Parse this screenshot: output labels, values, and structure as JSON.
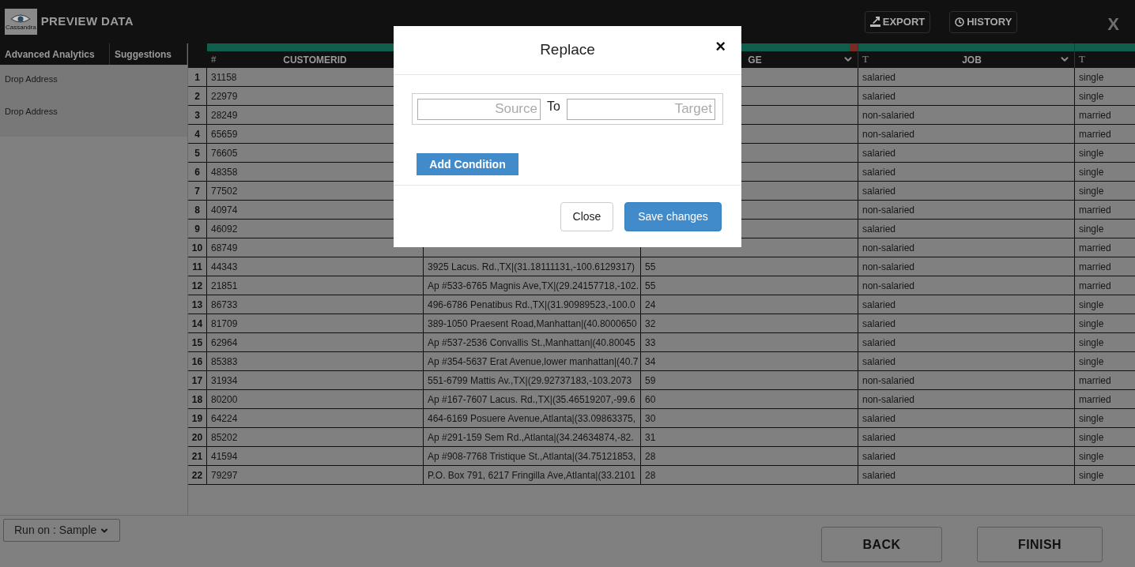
{
  "header": {
    "logo_text": "Cassandra",
    "title": "PREVIEW DATA",
    "actions": [
      {
        "kind": "export",
        "label": "EXPORT"
      },
      {
        "kind": "history",
        "label": "HISTORY"
      }
    ],
    "close": "X"
  },
  "sidebar": {
    "tabs": [
      "Advanced Analytics",
      "Suggestions"
    ],
    "items": [
      "Drop Address",
      "Drop Address"
    ]
  },
  "table": {
    "columns": [
      {
        "type_mark": "#",
        "label": "CUSTOMERID",
        "dropdown": false,
        "flagged": false
      },
      {},
      {
        "label": "GE",
        "dropdown": true,
        "flagged": true
      },
      {
        "type_mark": "T",
        "label": "JOB",
        "dropdown": true,
        "flagged": false
      },
      {
        "type_mark": "T",
        "dropdown": false,
        "flagged": false
      }
    ],
    "rows": [
      {
        "n": "1",
        "customerid": "31158",
        "job": "salaried",
        "column_6": "single"
      },
      {
        "n": "2",
        "customerid": "22979",
        "job": "salaried",
        "column_6": "single"
      },
      {
        "n": "3",
        "customerid": "28249",
        "job": "non-salaried",
        "column_6": "married"
      },
      {
        "n": "4",
        "customerid": "65659",
        "job": "non-salaried",
        "column_6": "married"
      },
      {
        "n": "5",
        "customerid": "76605",
        "job": "salaried",
        "column_6": "single"
      },
      {
        "n": "6",
        "customerid": "48358",
        "job": "salaried",
        "column_6": "single"
      },
      {
        "n": "7",
        "customerid": "77502",
        "job": "salaried",
        "column_6": "single"
      },
      {
        "n": "8",
        "customerid": "40974",
        "job": "non-salaried",
        "column_6": "married"
      },
      {
        "n": "9",
        "customerid": "46092",
        "job": "salaried",
        "column_6": "single"
      },
      {
        "n": "10",
        "customerid": "68749",
        "job": "non-salaried",
        "column_6": "married"
      },
      {
        "n": "11",
        "customerid": "44343",
        "column_3": "3925 Lacus. Rd.,TX|(31.18111131,-100.6129317)",
        "age": "55",
        "job": "non-salaried",
        "column_6": "married"
      },
      {
        "n": "12",
        "customerid": "21851",
        "column_3": "Ap #533-6765 Magnis Ave,TX|(29.24157718,-102.",
        "age": "55",
        "job": "non-salaried",
        "column_6": "married"
      },
      {
        "n": "13",
        "customerid": "86733",
        "column_3": "496-6786 Penatibus Rd.,TX|(31.90989523,-100.0",
        "age": "24",
        "job": "salaried",
        "column_6": "single"
      },
      {
        "n": "14",
        "customerid": "81709",
        "column_3": "389-1050 Praesent Road,Manhattan|(40.8000650",
        "age": "32",
        "job": "salaried",
        "column_6": "single"
      },
      {
        "n": "15",
        "customerid": "62964",
        "column_3": "Ap #537-2536 Convallis St.,Manhattan|(40.80045",
        "age": "33",
        "job": "salaried",
        "column_6": "single"
      },
      {
        "n": "16",
        "customerid": "85383",
        "column_3": "Ap #354-5637 Erat Avenue,lower manhattan|(40.7",
        "age": "34",
        "job": "salaried",
        "column_6": "single"
      },
      {
        "n": "17",
        "customerid": "31934",
        "column_3": "551-6799 Mattis Av.,TX|(29.92737183,-103.2073",
        "age": "59",
        "job": "non-salaried",
        "column_6": "married"
      },
      {
        "n": "18",
        "customerid": "80200",
        "column_3": "Ap #167-7607 Lacus. Rd.,TX|(35.46519207,-99.6",
        "age": "60",
        "job": "non-salaried",
        "column_6": "married"
      },
      {
        "n": "19",
        "customerid": "64224",
        "column_3": "464-6169 Posuere Avenue,Atlanta|(33.09863375,",
        "age": "30",
        "job": "salaried",
        "column_6": "single"
      },
      {
        "n": "20",
        "customerid": "85202",
        "column_3": "Ap #291-159 Sem Rd.,Atlanta|(34.24634874,-82.",
        "age": "31",
        "job": "salaried",
        "column_6": "single"
      },
      {
        "n": "21",
        "customerid": "41594",
        "column_3": "Ap #908-7768 Tristique St.,Atlanta|(34.75121853,",
        "age": "28",
        "job": "salaried",
        "column_6": "single"
      },
      {
        "n": "22",
        "customerid": "79297",
        "column_3": "P.O. Box 791, 6217 Fringilla Ave,Atlanta|(33.2101",
        "age": "28",
        "job": "salaried",
        "column_6": "single"
      }
    ]
  },
  "footer": {
    "run_on": "Run on : Sample",
    "buttons": [
      "BACK",
      "FINISH"
    ]
  },
  "modal": {
    "title": "Replace",
    "close": "×",
    "source": {
      "placeholder": "Source"
    },
    "joiner": "To",
    "target": {
      "placeholder": "Target"
    },
    "add_button": "Add Condition",
    "buttons": [
      {
        "kind": "default",
        "label": "Close"
      },
      {
        "kind": "primary",
        "label": "Save changes"
      }
    ]
  }
}
